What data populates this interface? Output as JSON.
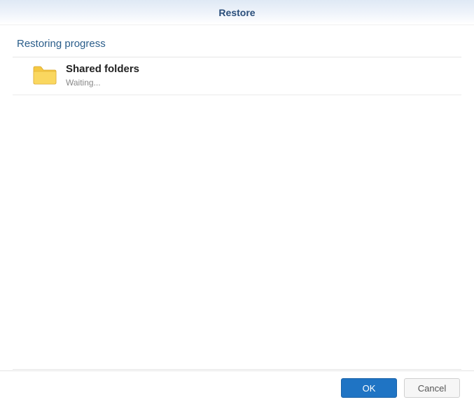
{
  "window": {
    "title": "Restore"
  },
  "section": {
    "heading": "Restoring progress"
  },
  "items": [
    {
      "icon": "folder-icon",
      "title": "Shared folders",
      "status": "Waiting..."
    }
  ],
  "buttons": {
    "ok": "OK",
    "cancel": "Cancel"
  }
}
